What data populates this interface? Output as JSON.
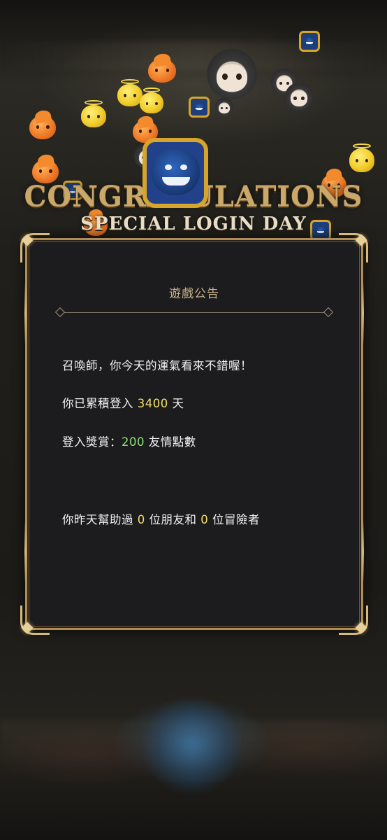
{
  "banner": {
    "title": "CONGRATULATIONS",
    "subtitle": "SPECIAL LOGIN DAY"
  },
  "notice": {
    "title": "遊戲公告",
    "greeting": "召喚師，你今天的運氣看來不錯喔！",
    "login_prefix": "你已累積登入",
    "login_days": "3400",
    "login_suffix": "天",
    "reward_prefix": "登入獎賞：",
    "reward_amount": "200",
    "reward_suffix": "友情點數",
    "help_prefix": "你昨天幫助過",
    "friends_helped": "0",
    "help_middle": "位朋友和",
    "adventurers_helped": "0",
    "help_suffix": "位冒險者"
  },
  "colors": {
    "highlight_yellow": "#f2df6a",
    "highlight_green": "#8fe07a",
    "frame_gold": "#b08d56"
  }
}
